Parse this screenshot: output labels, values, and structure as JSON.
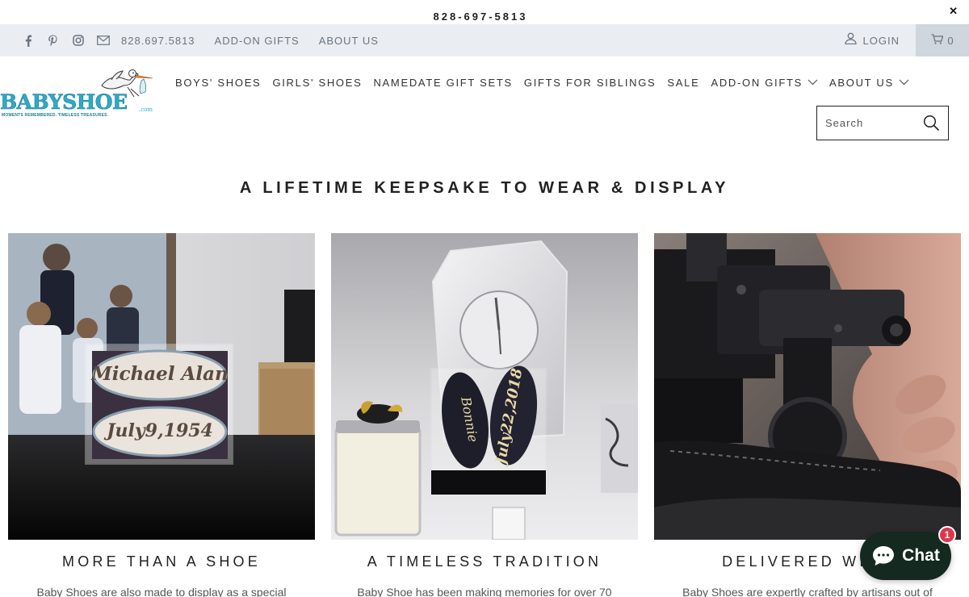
{
  "announcement": {
    "phone": "828-697-5813",
    "close": "✕"
  },
  "topbar": {
    "social_icons": [
      "facebook-icon",
      "pinterest-icon",
      "instagram-icon",
      "email-icon"
    ],
    "phone": "828.697.5813",
    "links": [
      "ADD-ON GIFTS",
      "ABOUT US"
    ],
    "login": "LOGIN",
    "cart_count": "0"
  },
  "logo": {
    "word": "BABYSHOE",
    "suffix": ".com",
    "tagline": "MOMENTS REMEMBERED. TIMELESS TREASURES."
  },
  "nav": {
    "items": [
      {
        "label": "BOYS' SHOES",
        "dropdown": false
      },
      {
        "label": "GIRLS' SHOES",
        "dropdown": false
      },
      {
        "label": "NAMEDATE GIFT SETS",
        "dropdown": false
      },
      {
        "label": "GIFTS FOR SIBLINGS",
        "dropdown": false
      },
      {
        "label": "SALE",
        "dropdown": false
      },
      {
        "label": "ADD-ON GIFTS",
        "dropdown": true
      },
      {
        "label": "ABOUT US",
        "dropdown": true
      }
    ]
  },
  "search": {
    "placeholder": "Search"
  },
  "section": {
    "heading": "A LIFETIME KEEPSAKE TO WEAR & DISPLAY"
  },
  "cards": [
    {
      "title": "MORE THAN A SHOE",
      "desc": "Baby Shoes are also made to display as a special",
      "engraving_1": "Michael Alan",
      "engraving_2": "July9,1954"
    },
    {
      "title": "A TIMELESS TRADITION",
      "desc": "Baby Shoe has been making memories for over 70",
      "engraving_1": "Bonnie",
      "engraving_2": "July22,2018"
    },
    {
      "title": "DELIVERED WITH",
      "desc": "Baby Shoes are expertly crafted by artisans out of"
    }
  ],
  "chat": {
    "label": "Chat",
    "badge": "1"
  },
  "colors": {
    "topbar_bg": "#eaeef2",
    "cart_bg": "#cfd6de",
    "logo_blue": "#2fa9c7",
    "chat_bg": "#14291f",
    "badge": "#e0364c"
  }
}
